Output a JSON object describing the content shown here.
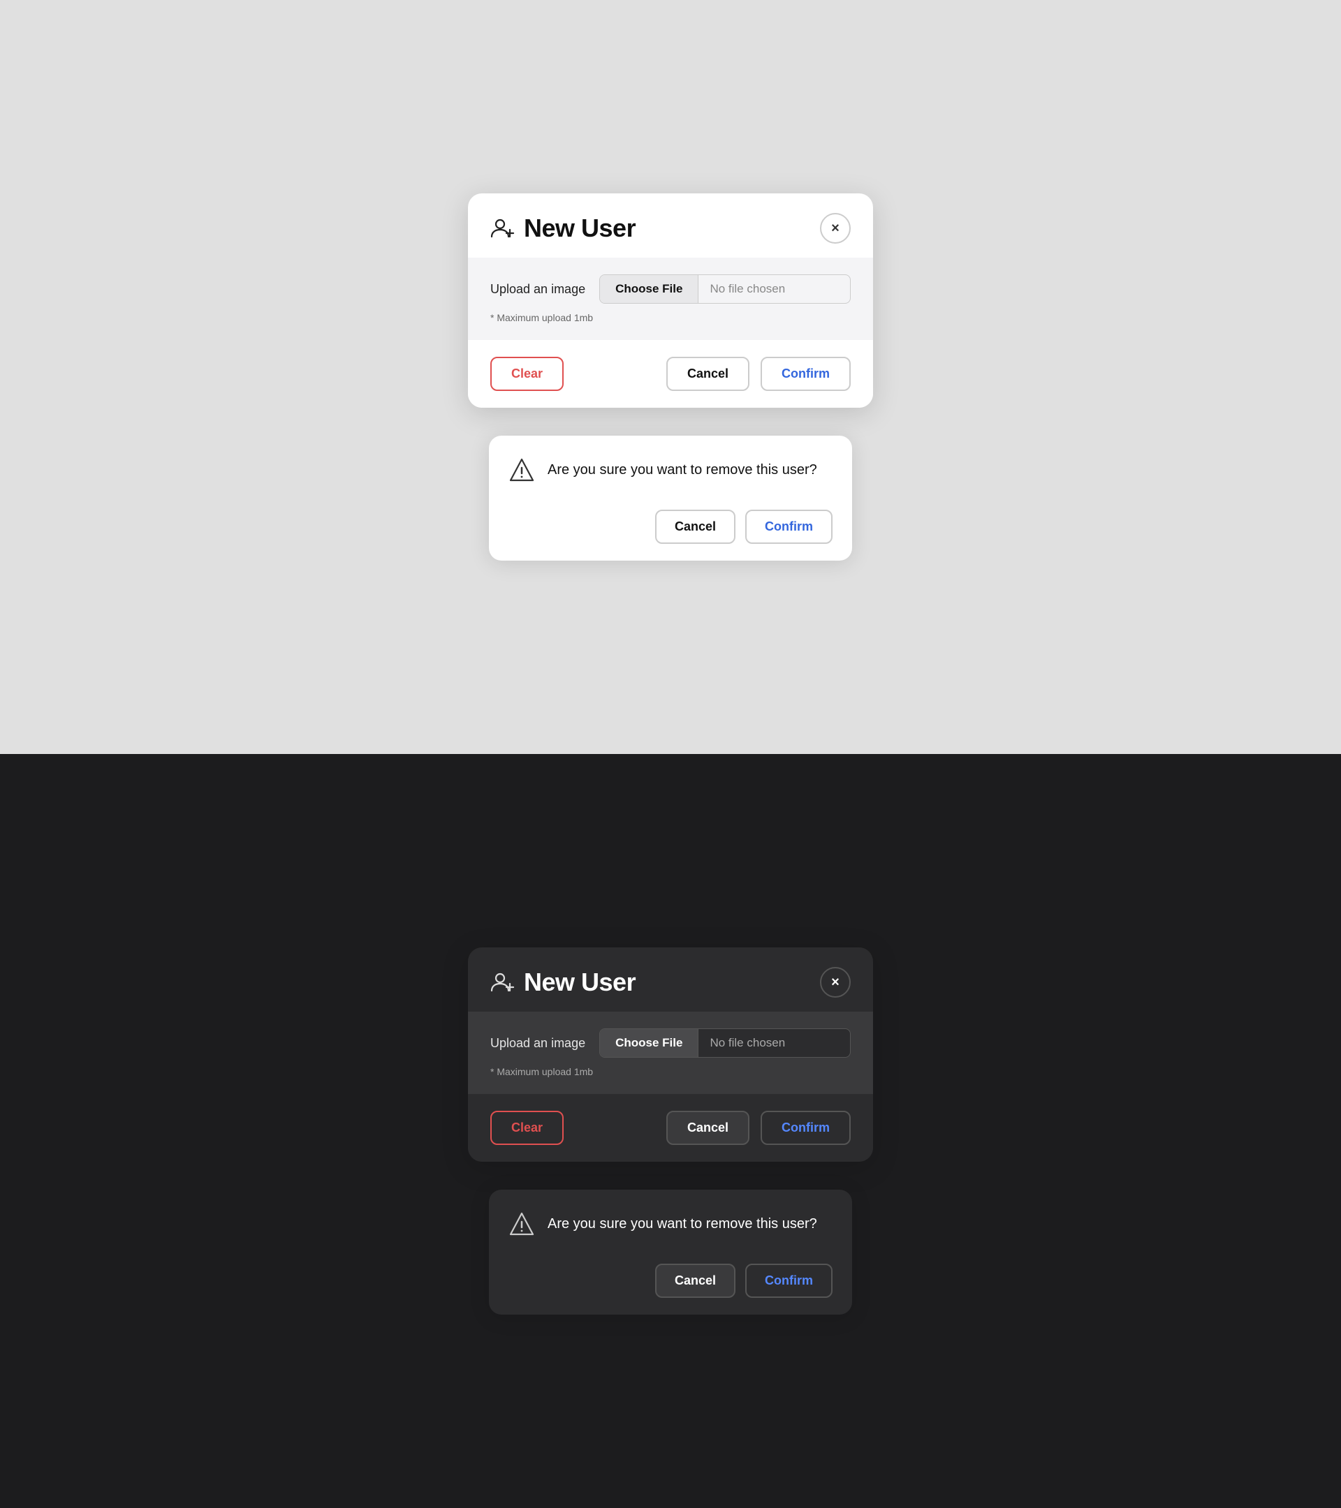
{
  "light": {
    "theme": "light",
    "modal": {
      "title": "New User",
      "close_label": "×",
      "upload_label": "Upload an image",
      "choose_file_label": "Choose File",
      "no_file_label": "No file chosen",
      "max_upload_note": "* Maximum upload 1mb",
      "clear_label": "Clear",
      "cancel_label": "Cancel",
      "confirm_label": "Confirm"
    },
    "confirm_dialog": {
      "message": "Are you sure you want to remove this user?",
      "cancel_label": "Cancel",
      "confirm_label": "Confirm"
    }
  },
  "dark": {
    "theme": "dark",
    "modal": {
      "title": "New User",
      "close_label": "×",
      "upload_label": "Upload an image",
      "choose_file_label": "Choose File",
      "no_file_label": "No file chosen",
      "max_upload_note": "* Maximum upload 1mb",
      "clear_label": "Clear",
      "cancel_label": "Cancel",
      "confirm_label": "Confirm"
    },
    "confirm_dialog": {
      "message": "Are you sure you want to remove this user?",
      "cancel_label": "Cancel",
      "confirm_label": "Confirm"
    }
  }
}
